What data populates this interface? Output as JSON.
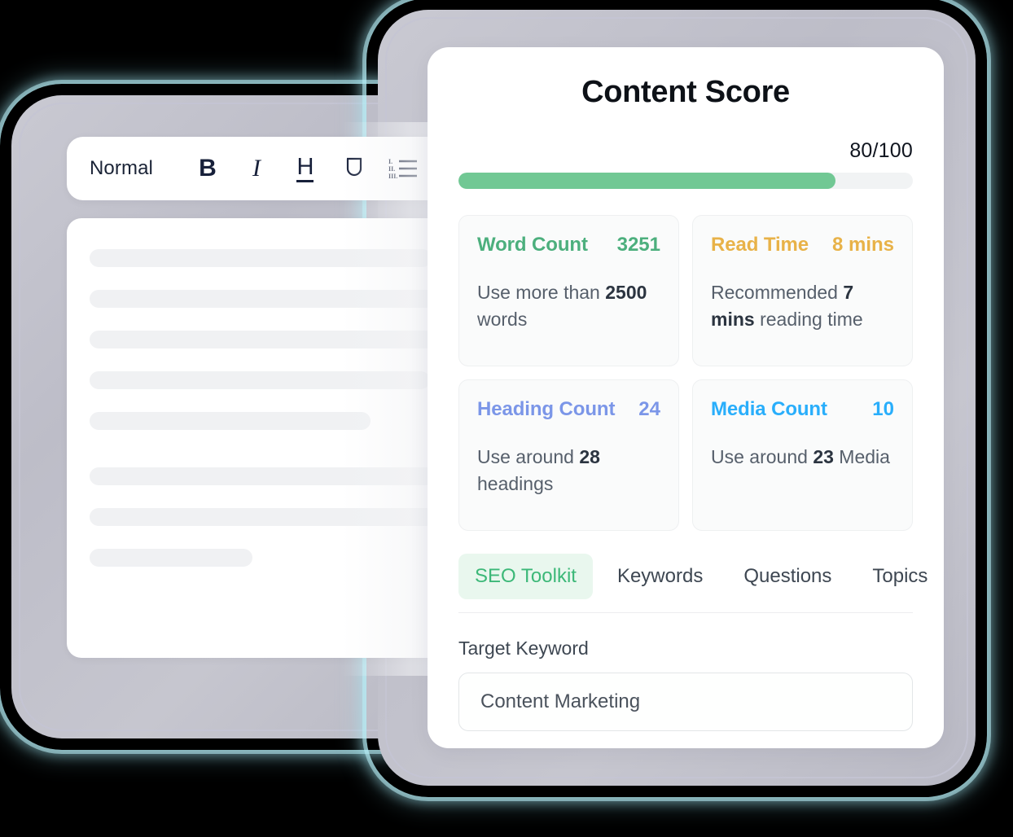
{
  "editor": {
    "style_dropdown": "Normal",
    "toolbar_tools": [
      {
        "name": "bold-icon",
        "glyph": "B"
      },
      {
        "name": "italic-icon",
        "glyph": "I"
      },
      {
        "name": "heading-icon",
        "glyph": "H"
      },
      {
        "name": "underline-icon",
        "glyph": "U"
      },
      {
        "name": "ordered-list-icon",
        "glyph": ""
      },
      {
        "name": "line-spacing-icon",
        "glyph": ""
      },
      {
        "name": "chevron-left-icon",
        "glyph": ""
      }
    ],
    "document_placeholder_lines": 8
  },
  "score_panel": {
    "title": "Content Score",
    "score_text": "80/100",
    "score_value": 80,
    "score_max": 100,
    "progress_percent": 83,
    "progress_color": "#71c894",
    "track_color": "#f1f3f4",
    "metrics": [
      {
        "label": "Word Count",
        "value": "3251",
        "color": "#4caf7d",
        "hint_prefix": "Use more than ",
        "hint_strong": "2500",
        "hint_suffix": " words"
      },
      {
        "label": "Read Time",
        "value": "8 mins",
        "color": "#e8b248",
        "hint_prefix": "Recommended ",
        "hint_strong": "7 mins",
        "hint_suffix": " reading time"
      },
      {
        "label": "Heading Count",
        "value": "24",
        "color": "#7b96e8",
        "hint_prefix": "Use around ",
        "hint_strong": "28",
        "hint_suffix": " headings"
      },
      {
        "label": "Media Count",
        "value": "10",
        "color": "#29aefb",
        "hint_prefix": "Use around ",
        "hint_strong": "23",
        "hint_suffix": " Media"
      }
    ],
    "tabs": [
      {
        "label": "SEO Toolkit",
        "active": true
      },
      {
        "label": "Keywords",
        "active": false
      },
      {
        "label": "Questions",
        "active": false
      },
      {
        "label": "Topics",
        "active": false
      }
    ],
    "target_keyword_label": "Target Keyword",
    "target_keyword_value": "Content Marketing",
    "target_keyword_placeholder": "Content Marketing"
  },
  "theme": {
    "accent_green": "#3cb878",
    "accent_green_soft": "#e9f7ee",
    "glow": "#aeeaf5",
    "device_frame": "#c2c2cc",
    "background": "#000000"
  }
}
